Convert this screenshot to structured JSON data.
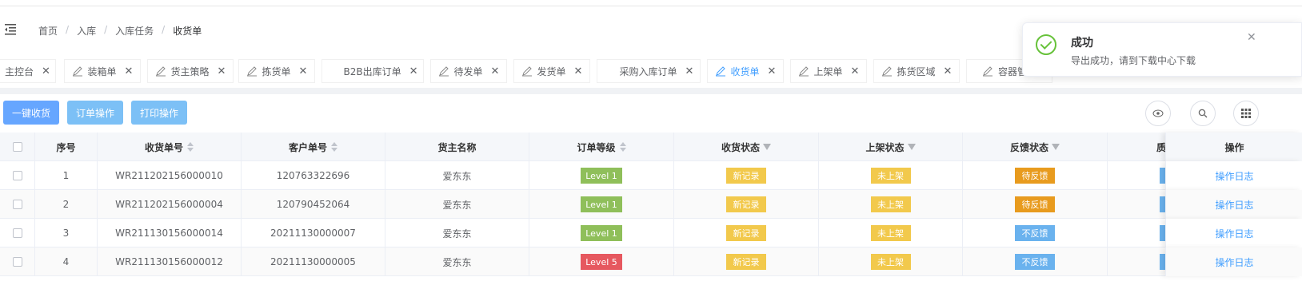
{
  "breadcrumb": [
    "首页",
    "入库",
    "入库任务",
    "收货单"
  ],
  "tabs": [
    {
      "label": "主控台",
      "active": false
    },
    {
      "label": "装箱单",
      "active": false
    },
    {
      "label": "货主策略",
      "active": false
    },
    {
      "label": "拣货单",
      "active": false
    },
    {
      "label": "B2B出库订单",
      "active": false
    },
    {
      "label": "待发单",
      "active": false
    },
    {
      "label": "发货单",
      "active": false
    },
    {
      "label": "采购入库订单",
      "active": false
    },
    {
      "label": "收货单",
      "active": true
    },
    {
      "label": "上架单",
      "active": false
    },
    {
      "label": "拣货区域",
      "active": false
    },
    {
      "label": "容器管理",
      "active": false
    }
  ],
  "toolbar": {
    "receive_all": "一键收货",
    "order_ops": "订单操作",
    "print_ops": "打印操作"
  },
  "table": {
    "headers": {
      "seq": "序号",
      "receipt_no": "收货单号",
      "customer_no": "客户单号",
      "owner": "货主名称",
      "level": "订单等级",
      "receive_status": "收货状态",
      "shelf_status": "上架状态",
      "feedback_status": "反馈状态",
      "quality": "质",
      "ops": "操作"
    },
    "rows": [
      {
        "seq": "1",
        "receipt_no": "WR211202156000010",
        "customer_no": "120763322696",
        "owner": "爱东东",
        "level": "Level 1",
        "receive_status": "新记录",
        "shelf_status": "未上架",
        "feedback_status": "待反馈",
        "ops": "操作日志"
      },
      {
        "seq": "2",
        "receipt_no": "WR211202156000004",
        "customer_no": "120790452064",
        "owner": "爱东东",
        "level": "Level 1",
        "receive_status": "新记录",
        "shelf_status": "未上架",
        "feedback_status": "待反馈",
        "ops": "操作日志"
      },
      {
        "seq": "3",
        "receipt_no": "WR211130156000014",
        "customer_no": "20211130000007",
        "owner": "爱东东",
        "level": "Level 1",
        "receive_status": "新记录",
        "shelf_status": "未上架",
        "feedback_status": "不反馈",
        "ops": "操作日志"
      },
      {
        "seq": "4",
        "receipt_no": "WR211130156000012",
        "customer_no": "20211130000005",
        "owner": "爱东东",
        "level": "Level 5",
        "receive_status": "新记录",
        "shelf_status": "未上架",
        "feedback_status": "不反馈",
        "ops": "操作日志"
      }
    ]
  },
  "notification": {
    "title": "成功",
    "message": "导出成功，请到下载中心下载"
  },
  "colors": {
    "level1": "#8fbf5a",
    "level5": "#e6585f",
    "new_record": "#f2c94c",
    "not_shelved": "#f2c94c",
    "pending_feedback": "#e89b1e",
    "no_feedback": "#6ab2ee",
    "link": "#409eff",
    "success": "#67c23a"
  }
}
